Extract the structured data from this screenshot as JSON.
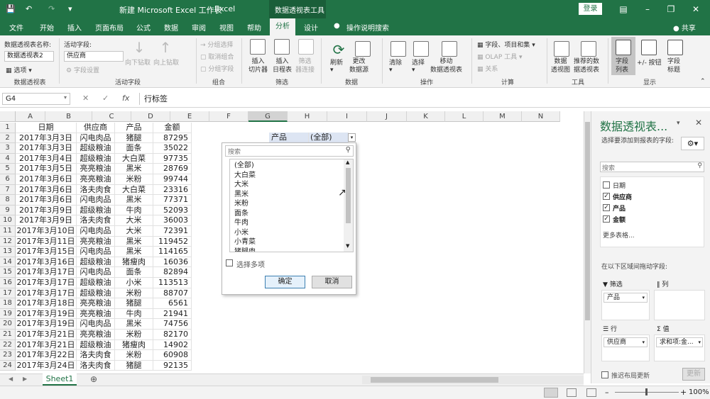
{
  "title": {
    "workbook": "新建 Microsoft Excel 工作表",
    "app": "Excel",
    "context": "数据透视表工具",
    "login": "登录"
  },
  "tabs": [
    "文件",
    "开始",
    "插入",
    "页面布局",
    "公式",
    "数据",
    "审阅",
    "视图",
    "帮助",
    "分析",
    "设计"
  ],
  "tell_me": "操作说明搜索",
  "share": "共享",
  "ribbon": {
    "pivot": {
      "name_label": "数据透视表名称:",
      "name_value": "数据透视表2",
      "options": "选项",
      "group": "数据透视表"
    },
    "active": {
      "label": "活动字段:",
      "value": "供应商",
      "settings": "字段设置",
      "drill_down": "向下钻取",
      "drill_up": "向上钻取",
      "group": "活动字段"
    },
    "grouping": {
      "sel": "→ 分组选择",
      "ungroup": "取消组合",
      "field": "分组字段",
      "group": "组合"
    },
    "filter": {
      "slicer": "插入\n切片器",
      "timeline": "插入\n日程表",
      "conn": "筛选\n器连接",
      "group": "筛选"
    },
    "data": {
      "refresh": "刷新",
      "change": "更改\n数据源",
      "group": "数据"
    },
    "actions": {
      "clear": "清除",
      "select": "选择",
      "move": "移动\n数据透视表",
      "group": "操作"
    },
    "calc": {
      "fields": "字段、项目和集",
      "olap": "OLAP 工具",
      "rel": "关系",
      "group": "计算"
    },
    "tools": {
      "chart": "数据\n透视图",
      "recommend": "推荐的数\n据透视表",
      "group": "工具"
    },
    "show": {
      "list": "字段\n列表",
      "buttons": "+/- 按钮",
      "headers": "字段\n标题",
      "group": "显示"
    }
  },
  "formula": {
    "namebox": "G4",
    "fx": "fx",
    "content": "行标签"
  },
  "columns": [
    "A",
    "B",
    "C",
    "D",
    "E",
    "F",
    "G",
    "H",
    "I",
    "J",
    "K",
    "L",
    "M",
    "N"
  ],
  "rows": [
    [
      "日期",
      "供应商",
      "产品",
      "金额"
    ],
    [
      "2017年3月3日",
      "闪电肉品",
      "猪腿",
      "87295"
    ],
    [
      "2017年3月3日",
      "超级粮油",
      "面条",
      "35022"
    ],
    [
      "2017年3月4日",
      "超级粮油",
      "大白菜",
      "97735"
    ],
    [
      "2017年3月5日",
      "亮亮粮油",
      "黑米",
      "28769"
    ],
    [
      "2017年3月6日",
      "亮亮粮油",
      "米粉",
      "99744"
    ],
    [
      "2017年3月6日",
      "洛夫肉食",
      "大白菜",
      "23316"
    ],
    [
      "2017年3月6日",
      "闪电肉品",
      "黑米",
      "77371"
    ],
    [
      "2017年3月9日",
      "超级粮油",
      "牛肉",
      "52093"
    ],
    [
      "2017年3月9日",
      "洛夫肉食",
      "大米",
      "36003"
    ],
    [
      "2017年3月10日",
      "闪电肉品",
      "大米",
      "72391"
    ],
    [
      "2017年3月11日",
      "亮亮粮油",
      "黑米",
      "119452"
    ],
    [
      "2017年3月15日",
      "闪电肉品",
      "黑米",
      "114165"
    ],
    [
      "2017年3月16日",
      "超级粮油",
      "猪瘦肉",
      "16036"
    ],
    [
      "2017年3月17日",
      "闪电肉品",
      "面条",
      "82894"
    ],
    [
      "2017年3月17日",
      "超级粮油",
      "小米",
      "113513"
    ],
    [
      "2017年3月17日",
      "超级粮油",
      "米粉",
      "88707"
    ],
    [
      "2017年3月18日",
      "亮亮粮油",
      "猪腿",
      "6561"
    ],
    [
      "2017年3月19日",
      "亮亮粮油",
      "牛肉",
      "21941"
    ],
    [
      "2017年3月19日",
      "闪电肉品",
      "黑米",
      "74756"
    ],
    [
      "2017年3月21日",
      "亮亮粮油",
      "米粉",
      "82170"
    ],
    [
      "2017年3月21日",
      "超级粮油",
      "猪瘦肉",
      "14902"
    ],
    [
      "2017年3月22日",
      "洛夫肉食",
      "米粉",
      "60908"
    ],
    [
      "2017年3月24日",
      "洛夫肉食",
      "猪腿",
      "92135"
    ]
  ],
  "pivot_filter": {
    "label": "产品",
    "value": "(全部)"
  },
  "dropdown": {
    "search_placeholder": "搜索",
    "items": [
      "(全部)",
      "大白菜",
      "大米",
      "黑米",
      "米粉",
      "面条",
      "牛肉",
      "小米",
      "小青菜",
      "猪腿肉"
    ],
    "multi": "选择多项",
    "ok": "确定",
    "cancel": "取消"
  },
  "pane": {
    "title": "数据透视表...",
    "subtitle": "选择要添加到报表的字段:",
    "search": "搜索",
    "fields": [
      {
        "name": "日期",
        "checked": false
      },
      {
        "name": "供应商",
        "checked": true
      },
      {
        "name": "产品",
        "checked": true
      },
      {
        "name": "金额",
        "checked": true
      }
    ],
    "more": "更多表格...",
    "drag": "在以下区域间拖动字段:",
    "filter_label": "筛选",
    "col_label": "列",
    "filter_item": "产品",
    "row_label": "行",
    "row_item": "供应商",
    "val_label": "值",
    "val_item": "求和项:金...",
    "defer": "推迟布局更新",
    "update": "更新"
  },
  "sheet_tab": "Sheet1",
  "zoom": "100%"
}
